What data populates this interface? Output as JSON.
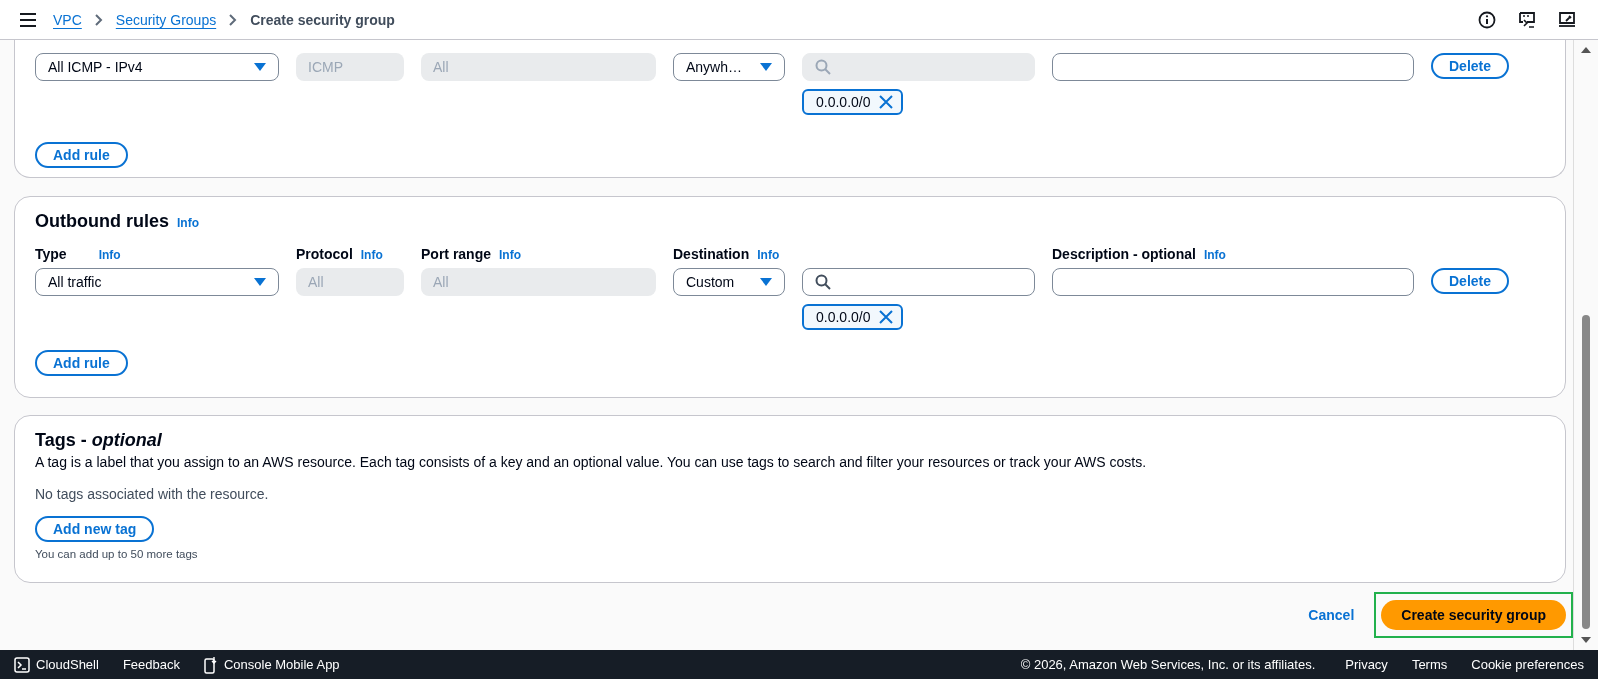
{
  "breadcrumbs": [
    {
      "label": "VPC",
      "link": true
    },
    {
      "label": "Security Groups",
      "link": true
    },
    {
      "label": "Create security group",
      "link": false
    }
  ],
  "inbound_rules": {
    "rows": [
      {
        "type": "All ICMP - IPv4",
        "protocol": "ICMP",
        "port_range": "All",
        "destination": "Anywh…",
        "search_disabled": true,
        "chips": [
          "0.0.0.0/0"
        ],
        "delete": "Delete"
      }
    ],
    "add_rule": "Add rule"
  },
  "outbound_rules": {
    "title": "Outbound rules",
    "info": "Info",
    "columns": [
      {
        "label": "Type",
        "info": "Info"
      },
      {
        "label": "Protocol",
        "info": "Info"
      },
      {
        "label": "Port range",
        "info": "Info"
      },
      {
        "label": "Destination",
        "info": "Info"
      },
      {
        "label": "Description - optional",
        "info": "Info"
      }
    ],
    "rows": [
      {
        "type": "All traffic",
        "protocol": "All",
        "port_range": "All",
        "destination": "Custom",
        "search_disabled": false,
        "chips": [
          "0.0.0.0/0"
        ],
        "delete": "Delete"
      }
    ],
    "add_rule": "Add rule"
  },
  "tags": {
    "title": "Tags - *optional*",
    "description": "A tag is a label that you assign to an AWS resource. Each tag consists of a key and an optional value. You can use tags to search and filter your resources or track your AWS costs.",
    "empty_note": "No tags associated with the resource.",
    "add_button": "Add new tag",
    "hint": "You can add up to 50 more tags"
  },
  "actions": {
    "cancel": "Cancel",
    "create": "Create security group",
    "create_highlighted": true
  },
  "footer": {
    "left": [
      {
        "kind": "terminal",
        "label": "CloudShell"
      },
      {
        "kind": "plain",
        "label": "Feedback"
      },
      {
        "kind": "phone",
        "label": "Console Mobile App"
      }
    ],
    "copyright": "© 2026, Amazon Web Services, Inc. or its affiliates.",
    "links": [
      "Privacy",
      "Terms",
      "Cookie preferences"
    ]
  }
}
